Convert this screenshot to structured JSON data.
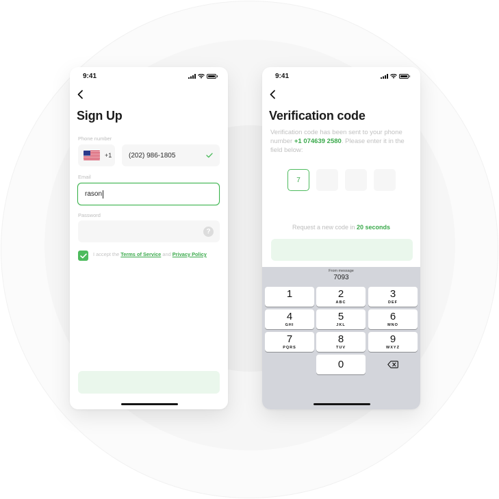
{
  "status_bar": {
    "time": "9:41"
  },
  "signup": {
    "title": "Sign Up",
    "phone_label": "Phone number",
    "country_code": "+1",
    "phone_value": "(202) 986-1805",
    "email_label": "Email",
    "email_value": "rason",
    "password_label": "Password",
    "password_value": "",
    "help_glyph": "?",
    "terms_prefix": "I accept the ",
    "terms_link": "Terms of Service",
    "terms_and": " and ",
    "privacy_link": "Privacy Policy",
    "submit_label": ""
  },
  "verification": {
    "title": "Verification code",
    "desc_prefix": "Verification code has been sent to your phone number ",
    "phone": "+1 074639 2580",
    "desc_suffix": ". Please enter it in the field below:",
    "code_digits": [
      "7",
      "",
      "",
      ""
    ],
    "resend_prefix": "Request a new code in ",
    "resend_time": "20 seconds",
    "submit_label": ""
  },
  "keypad": {
    "suggestion_label": "From message",
    "suggestion_value": "7093",
    "keys": [
      {
        "digit": "1",
        "letters": ""
      },
      {
        "digit": "2",
        "letters": "ABC"
      },
      {
        "digit": "3",
        "letters": "DEF"
      },
      {
        "digit": "4",
        "letters": "GHI"
      },
      {
        "digit": "5",
        "letters": "JKL"
      },
      {
        "digit": "6",
        "letters": "MNO"
      },
      {
        "digit": "7",
        "letters": "PQRS"
      },
      {
        "digit": "8",
        "letters": "TUV"
      },
      {
        "digit": "9",
        "letters": "WXYZ"
      },
      {
        "digit": "0",
        "letters": ""
      }
    ]
  },
  "colors": {
    "accent_green": "#38b24a",
    "button_disabled": "#eaf7ec",
    "field_bg": "#f6f6f6",
    "keyboard_bg": "#d3d5db"
  },
  "icons": {
    "back": "chevron-left-icon",
    "check": "check-icon",
    "help": "question-mark-icon",
    "backspace": "backspace-icon",
    "flag": "us-flag-icon"
  }
}
